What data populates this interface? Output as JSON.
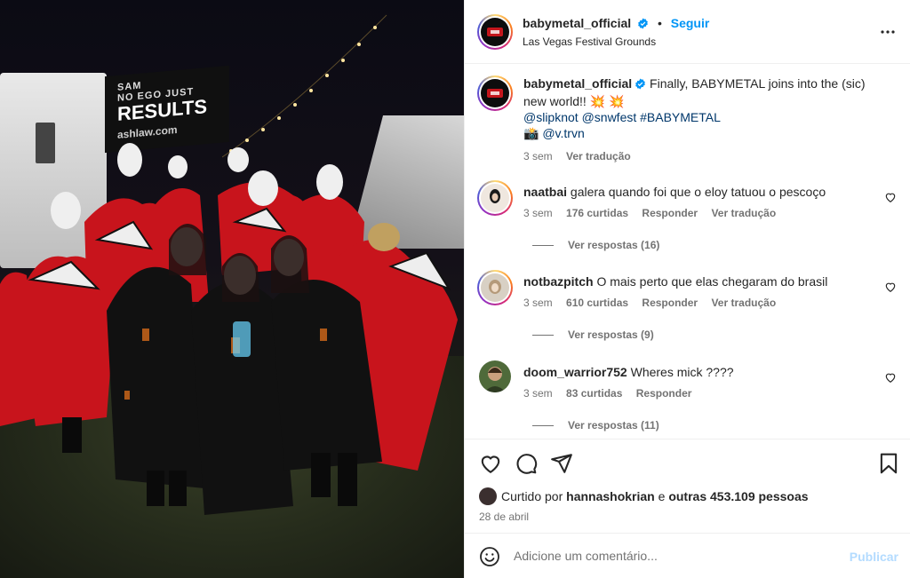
{
  "post": {
    "username": "babymetal_official",
    "follow_label": "Seguir",
    "separator": "•",
    "location": "Las Vegas Festival Grounds",
    "banner_lines": [
      "SAM",
      "NO EGO JUST",
      "RESULTS",
      "ashlaw.com"
    ]
  },
  "caption": {
    "username": "babymetal_official",
    "text": "Finally, BABYMETAL joins into the (sic) new world!! 💥 💥",
    "tags": "@slipknot @snwfest #BABYMETAL",
    "credit_icon": "📸",
    "credit": "@v.trvn",
    "time": "3 sem",
    "translate": "Ver tradução"
  },
  "comments": [
    {
      "username": "naatbai",
      "text": "galera quando foi que o eloy tatuou o pescoço",
      "time": "3 sem",
      "likes": "176 curtidas",
      "reply": "Responder",
      "translate": "Ver tradução",
      "view_replies": "Ver respostas (16)"
    },
    {
      "username": "notbazpitch",
      "text": "O mais perto que elas chegaram do brasil",
      "time": "3 sem",
      "likes": "610 curtidas",
      "reply": "Responder",
      "translate": "Ver tradução",
      "view_replies": "Ver respostas (9)"
    },
    {
      "username": "doom_warrior752",
      "text": "Wheres mick ????",
      "time": "3 sem",
      "likes": "83 curtidas",
      "reply": "Responder",
      "view_replies": "Ver respostas (11)"
    }
  ],
  "likes": {
    "prefix": "Curtido por",
    "user": "hannashokrian",
    "middle": "e",
    "others": "outras 453.109 pessoas"
  },
  "date": "28 de abril",
  "comment_box": {
    "placeholder": "Adicione um comentário...",
    "publish": "Publicar"
  },
  "colors": {
    "link_blue": "#0095f6",
    "mention_dark_blue": "#00376b",
    "secondary_text": "#737373",
    "border": "#efefef"
  }
}
